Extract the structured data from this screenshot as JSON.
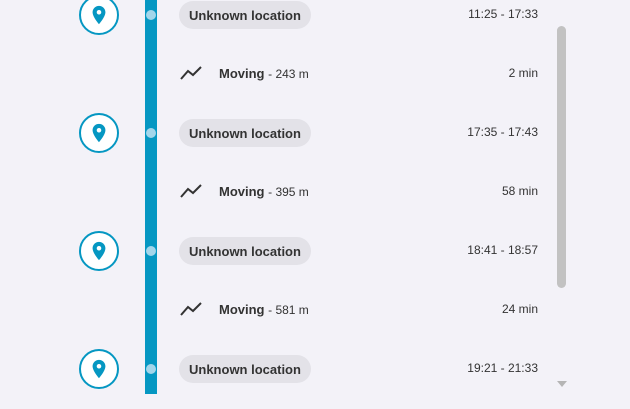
{
  "colors": {
    "accent": "#0597c2",
    "pill": "#e3e2e8",
    "background": "#f3f2f8"
  },
  "stops": [
    {
      "location": "Unknown location",
      "time": "11:25 - 17:33",
      "icon": "map-pin-icon"
    },
    {
      "location": "Unknown location",
      "time": "17:35 - 17:43",
      "icon": "map-pin-icon"
    },
    {
      "location": "Unknown location",
      "time": "18:41 - 18:57",
      "icon": "map-pin-icon"
    },
    {
      "location": "Unknown location",
      "time": "19:21 - 21:33",
      "icon": "map-pin-icon"
    }
  ],
  "moves": [
    {
      "label": "Moving",
      "distance": "- 243 m",
      "duration": "2 min",
      "icon": "trend-line-icon"
    },
    {
      "label": "Moving",
      "distance": "- 395 m",
      "duration": "58 min",
      "icon": "trend-line-icon"
    },
    {
      "label": "Moving",
      "distance": "- 581 m",
      "duration": "24 min",
      "icon": "trend-line-icon"
    }
  ]
}
